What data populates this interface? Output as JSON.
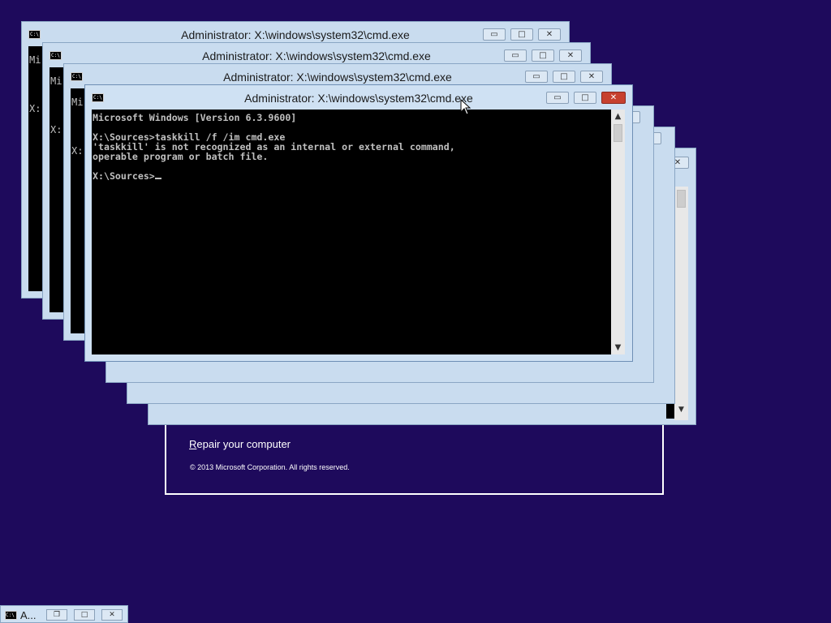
{
  "setup": {
    "repair_link_first": "R",
    "repair_link_rest": "epair your computer",
    "copyright": "© 2013 Microsoft Corporation. All rights reserved."
  },
  "window_title": "Administrator: X:\\windows\\system32\\cmd.exe",
  "sysicon_text": "C:\\",
  "controls": {
    "minimize": "▭",
    "maximize": "□",
    "close": "✕",
    "restore": "❐"
  },
  "back_windows": {
    "peek_1": "Mi\n\nX:",
    "peek_2": "Mi\n\nX:",
    "peek_3": "Mi\n\nX:"
  },
  "console": {
    "lines": [
      "Microsoft Windows [Version 6.3.9600]",
      "",
      "X:\\Sources>taskkill /f /im cmd.exe",
      "'taskkill' is not recognized as an internal or external command,",
      "operable program or batch file.",
      "",
      "X:\\Sources>"
    ]
  },
  "scroll": {
    "up": "▲",
    "down": "▼"
  },
  "minimized": {
    "label": "A..."
  },
  "colors": {
    "desktop": "#1e0a5c",
    "frame": "#cfe1f3",
    "close_active": "#c7412f",
    "console_bg": "#000000",
    "console_text": "#c0c0c0"
  }
}
